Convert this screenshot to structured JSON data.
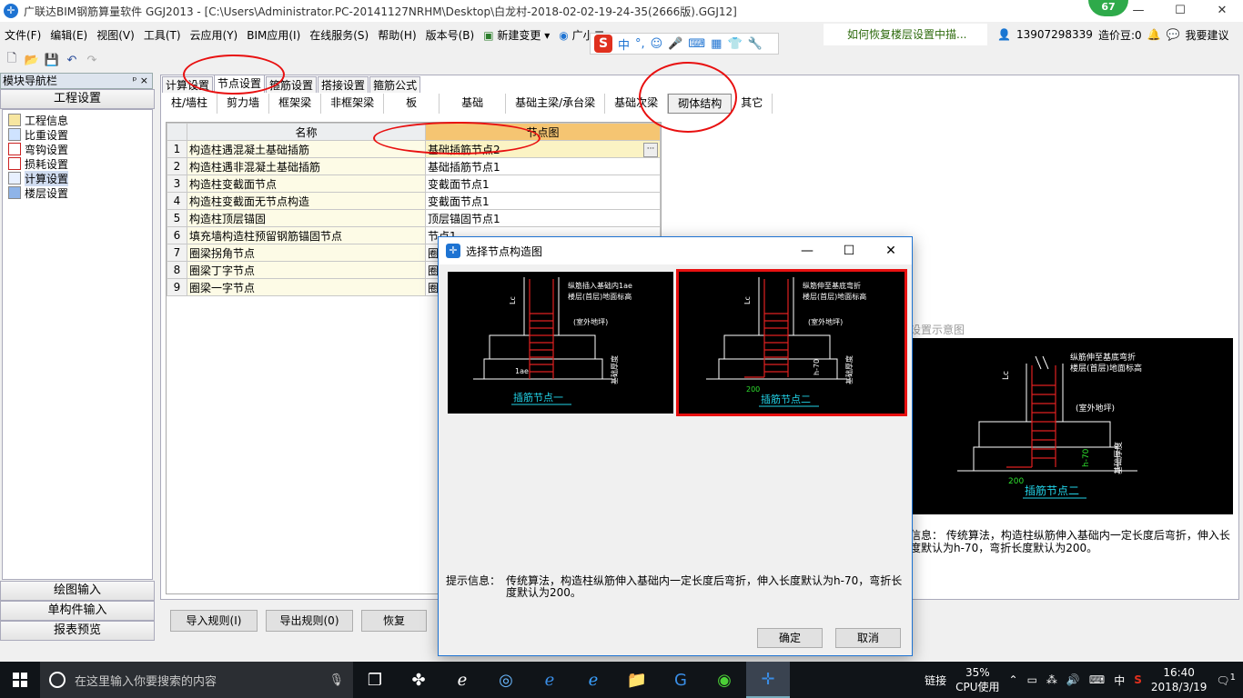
{
  "window": {
    "title": "广联达BIM钢筋算量软件 GGJ2013 - [C:\\Users\\Administrator.PC-20141127NRHM\\Desktop\\白龙村-2018-02-02-19-24-35(2666版).GGJ12]",
    "badge": "67",
    "minimize": "—",
    "maximize": "☐",
    "close": "✕"
  },
  "menu": {
    "items": [
      "文件(F)",
      "编辑(E)",
      "视图(V)",
      "工具(T)",
      "云应用(Y)",
      "BIM应用(I)",
      "在线服务(S)",
      "帮助(H)",
      "版本号(B)",
      "新建变更",
      "广小二"
    ],
    "help_link": "如何恢复楼层设置中描...",
    "phone": "13907298339",
    "coins": "造价豆:0",
    "suggest": "我要建议"
  },
  "ime": {
    "logo": "S",
    "mode": "中"
  },
  "nav": {
    "header": "模块导航栏",
    "pin": "ᵖ ×",
    "section_top": "工程设置",
    "items": [
      "工程信息",
      "比重设置",
      "弯钩设置",
      "损耗设置",
      "计算设置",
      "楼层设置"
    ],
    "selected_index": 4,
    "bottom_sections": [
      "绘图输入",
      "单构件输入",
      "报表预览"
    ]
  },
  "tabs": [
    "计算设置",
    "节点设置",
    "箍筋设置",
    "搭接设置",
    "箍筋公式"
  ],
  "active_tab": 1,
  "subtabs": [
    "柱/墙柱",
    "剪力墙",
    "框架梁",
    "非框架梁",
    "板",
    "基础",
    "基础主梁/承台梁",
    "基础次梁",
    "砌体结构",
    "其它"
  ],
  "active_subtab": 8,
  "grid": {
    "headers": {
      "name": "名称",
      "node": "节点图"
    },
    "rows": [
      {
        "n": "1",
        "name": "构造柱遇混凝土基础插筋",
        "node": "基础插筋节点2"
      },
      {
        "n": "2",
        "name": "构造柱遇非混凝土基础插筋",
        "node": "基础插筋节点1"
      },
      {
        "n": "3",
        "name": "构造柱变截面节点",
        "node": "变截面节点1"
      },
      {
        "n": "4",
        "name": "构造柱变截面无节点构造",
        "node": "变截面节点1"
      },
      {
        "n": "5",
        "name": "构造柱顶层锚固",
        "node": "顶层锚固节点1"
      },
      {
        "n": "6",
        "name": "填充墙构造柱预留钢筋锚固节点",
        "node": "节点1"
      },
      {
        "n": "7",
        "name": "圈梁拐角节点",
        "node": "圈"
      },
      {
        "n": "8",
        "name": "圈梁丁字节点",
        "node": "圈"
      },
      {
        "n": "9",
        "name": "圈梁一字节点",
        "node": "圈"
      }
    ],
    "ellipsis": "···"
  },
  "preview": {
    "title": "设置示意图",
    "info": "信息： 传统算法，构造柱纵筋伸入基础内一定长度后弯折，伸入长度默认为h-70，弯折长度默认为200。",
    "caption": "插筋节点二",
    "labels": {
      "lc": "Lc",
      "top": "纵筋伸至基底弯折",
      "floor": "楼层(首层)地面标高",
      "outdoor": "(室外地坪)",
      "h70": "h-70",
      "thick": "基础厚度",
      "len": "200"
    }
  },
  "main_buttons": {
    "import": "导入规则(I)",
    "export": "导出规则(0)",
    "restore": "恢复"
  },
  "dialog": {
    "title": "选择节点构造图",
    "min": "—",
    "max": "☐",
    "close": "✕",
    "thumbs": [
      {
        "caption": "插筋节点一",
        "top": "纵筋插入基础内1ae",
        "floor": "楼层(首层)地面标高",
        "outdoor": "(室外地坪)",
        "lc": "Lc",
        "side": "1ae",
        "thick": "基础厚度"
      },
      {
        "caption": "插筋节点二",
        "top": "纵筋伸至基底弯折",
        "floor": "楼层(首层)地面标高",
        "outdoor": "(室外地坪)",
        "lc": "Lc",
        "side": "h-70",
        "len": "200",
        "thick": "基础厚度"
      }
    ],
    "selected": 1,
    "info_label": "提示信息：",
    "info": "传统算法，构造柱纵筋伸入基础内一定长度后弯折，伸入长度默认为h-70，弯折长度默认为200。",
    "ok": "确定",
    "cancel": "取消"
  },
  "taskbar": {
    "search_placeholder": "在这里输入你要搜索的内容",
    "link": "链接",
    "cpu_pct": "35%",
    "cpu_label": "CPU使用",
    "ime": "中",
    "time": "16:40",
    "date": "2018/3/19",
    "notif": "1"
  },
  "colors": {
    "accent": "#1e73d2",
    "annotation": "#e81010",
    "header_node": "#f5c572",
    "drawing_red": "#e02020",
    "drawing_line": "#ffffff",
    "caption": "#22d3e8"
  }
}
